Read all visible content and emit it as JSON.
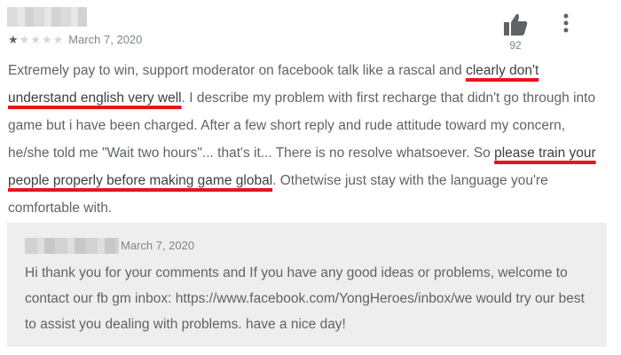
{
  "review": {
    "reviewer_name": "",
    "rating": {
      "stars_filled": 1,
      "stars_total": 5
    },
    "date": "March 7, 2020",
    "helpful_count": "92",
    "icons": {
      "thumbs_up": "thumbs-up-icon",
      "more": "more-vert-icon"
    },
    "body": {
      "p1": "Extremely pay to win, support moderator on facebook talk like a rascal and ",
      "hl1": "clearly don't understand english very well",
      "p2": ". I describe my problem with first recharge that didn't go through into game but i have been charged. After a few short reply and rude attitude toward my concern, he/she told me \"Wait two hours\"... that's it... There is no resolve whatsoever. So ",
      "hl2": "please train your people properly before making game global",
      "p3": ". Othetwise just stay with the language you're comfortable with."
    },
    "highlight_color": "#e8141b"
  },
  "reply": {
    "developer_name": "",
    "date": "March 7, 2020",
    "text": "Hi thank you for your comments and If you have any good ideas or problems, welcome to contact our fb gm inbox: https://www.facebook.com/YongHeroes/inbox/we would try our best to assist you dealing with problems. have a nice day!"
  }
}
